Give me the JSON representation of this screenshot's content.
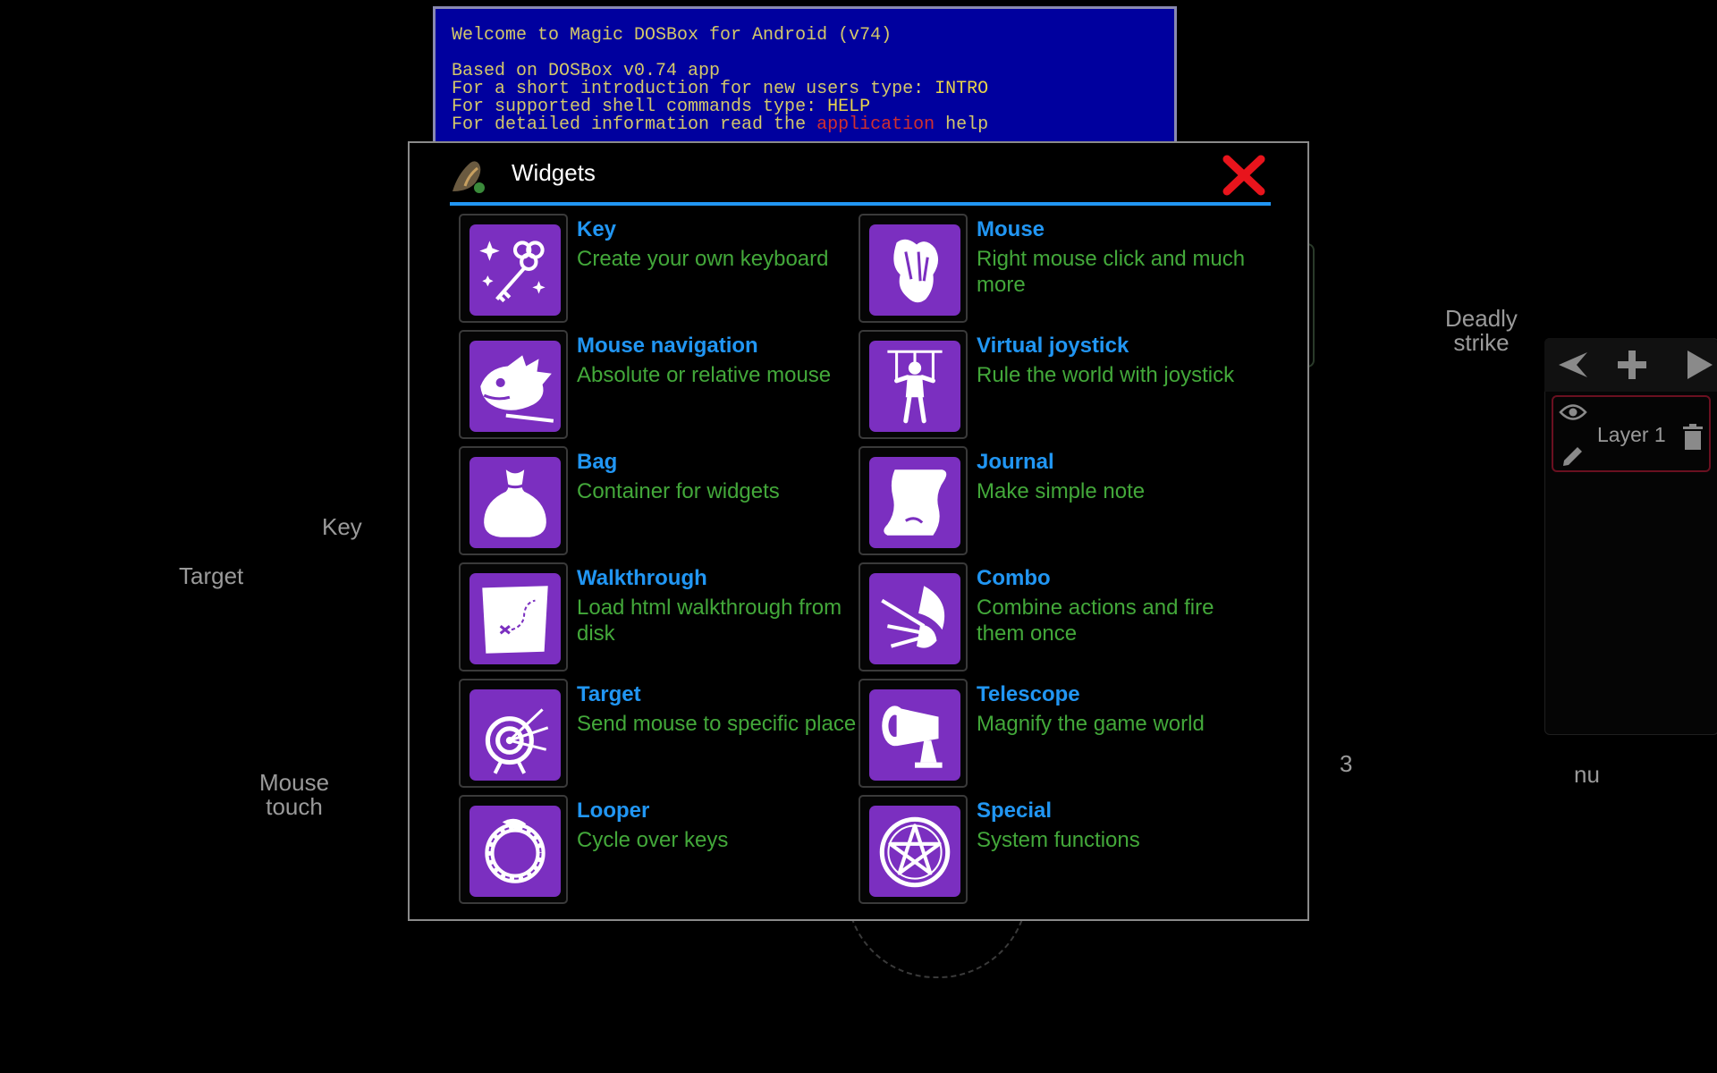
{
  "dos_console": {
    "line1": "Welcome to Magic DOSBox for Android (v74)",
    "line2": "Based on DOSBox v0.74 app",
    "line3_a": "For a short introduction for new users type: ",
    "line3_b": "INTRO",
    "line4_a": "For supported shell commands type: ",
    "line4_b": "HELP",
    "line5_a": "For detailed information read the ",
    "line5_b": "application",
    "line5_c": " help"
  },
  "background_labels": {
    "key": "Key",
    "target": "Target",
    "mouse_touch_1": "Mouse",
    "mouse_touch_2": "touch",
    "deadly_strike_1": "Deadly",
    "deadly_strike_2": "strike",
    "three": "3",
    "nu": "nu"
  },
  "layers_panel": {
    "layer_name": "Layer 1"
  },
  "dialog": {
    "title": "Widgets",
    "accent_color": "#2196f3",
    "widgets": [
      {
        "title": "Key",
        "description": "Create your own keyboard",
        "icon": "magic-keys-icon"
      },
      {
        "title": "Mouse",
        "description": "Right mouse click and much more",
        "icon": "claw-icon"
      },
      {
        "title": "Mouse navigation",
        "description": "Absolute or relative mouse",
        "icon": "beast-head-icon"
      },
      {
        "title": "Virtual joystick",
        "description": "Rule the world with joystick",
        "icon": "marionette-icon"
      },
      {
        "title": "Bag",
        "description": "Container for widgets",
        "icon": "bag-icon"
      },
      {
        "title": "Journal",
        "description": "Make simple note",
        "icon": "scroll-icon"
      },
      {
        "title": "Walkthrough",
        "description": "Load html walkthrough from disk",
        "icon": "treasure-map-icon"
      },
      {
        "title": "Combo",
        "description": "Combine actions and fire them once",
        "icon": "combo-strike-icon"
      },
      {
        "title": "Target",
        "description": "Send mouse to specific place",
        "icon": "archery-target-icon"
      },
      {
        "title": "Telescope",
        "description": "Magnify the game world",
        "icon": "telescope-icon"
      },
      {
        "title": "Looper",
        "description": "Cycle over keys",
        "icon": "ouroboros-icon"
      },
      {
        "title": "Special",
        "description": "System functions",
        "icon": "pentagram-icon"
      }
    ]
  }
}
